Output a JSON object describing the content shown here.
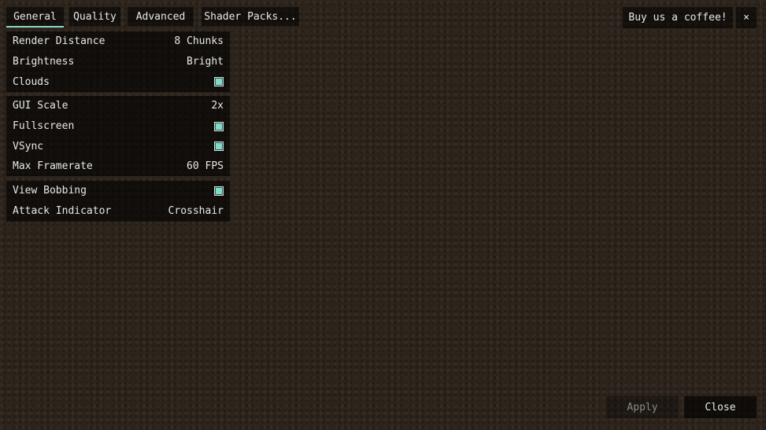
{
  "tabs": [
    {
      "label": "General",
      "selected": true
    },
    {
      "label": "Quality"
    },
    {
      "label": "Advanced"
    },
    {
      "label": "Shader Packs..."
    }
  ],
  "coffee_button": "Buy us a coffee!",
  "close_icon": "×",
  "groups": [
    [
      {
        "label": "Render Distance",
        "value": "8 Chunks"
      },
      {
        "label": "Brightness",
        "value": "Bright"
      },
      {
        "label": "Clouds",
        "checked": true
      }
    ],
    [
      {
        "label": "GUI Scale",
        "value": "2x"
      },
      {
        "label": "Fullscreen",
        "checked": true
      },
      {
        "label": "VSync",
        "checked": true
      },
      {
        "label": "Max Framerate",
        "value": "60 FPS"
      }
    ],
    [
      {
        "label": "View Bobbing",
        "checked": true
      },
      {
        "label": "Attack Indicator",
        "value": "Crosshair"
      }
    ]
  ],
  "footer": {
    "apply": "Apply",
    "close": "Close"
  },
  "colors": {
    "accent": "#8fd8c8",
    "background": "#2d241c"
  }
}
